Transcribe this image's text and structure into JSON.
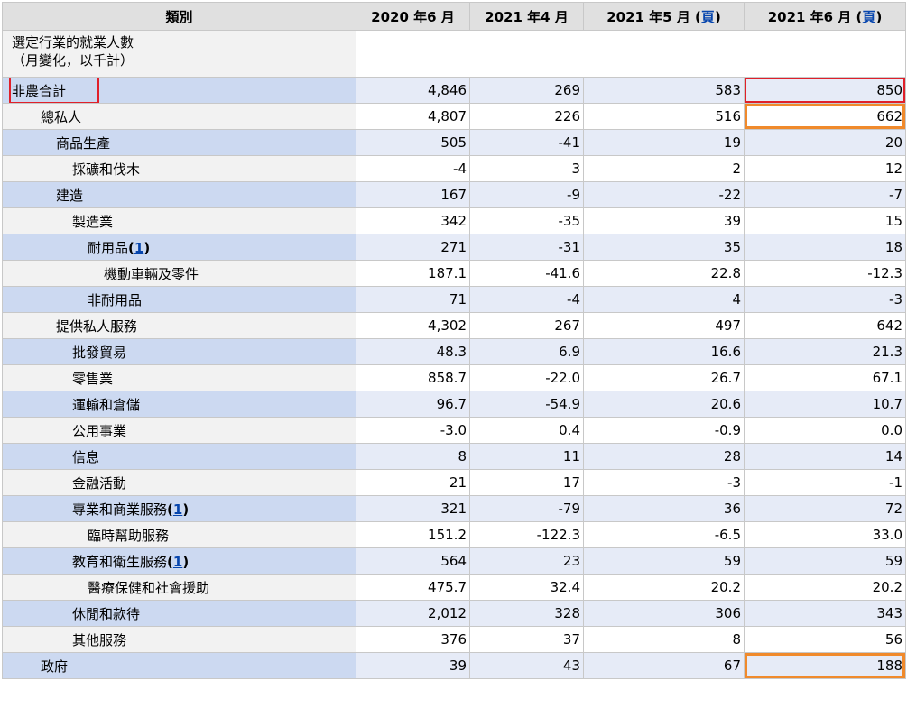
{
  "header": {
    "category": "類別",
    "col1": "2020 年6 月",
    "col2": "2021 年4 月",
    "col3_prefix": "2021 年5 月 (",
    "col3_link": "頁",
    "col3_suffix": ")",
    "col4_prefix": "2021 年6 月 (",
    "col4_link": "頁",
    "col4_suffix": ")"
  },
  "intro": {
    "line1": "選定行業的就業人數",
    "line2": "（月變化，以千計）"
  },
  "rows": [
    {
      "label": "非農合計",
      "note": "",
      "v": [
        "4,846",
        "269",
        "583",
        "850"
      ]
    },
    {
      "label": "總私人",
      "note": "",
      "v": [
        "4,807",
        "226",
        "516",
        "662"
      ]
    },
    {
      "label": "商品生產",
      "note": "",
      "v": [
        "505",
        "-41",
        "19",
        "20"
      ]
    },
    {
      "label": "採礦和伐木",
      "note": "",
      "v": [
        "-4",
        "3",
        "2",
        "12"
      ]
    },
    {
      "label": "建造",
      "note": "",
      "v": [
        "167",
        "-9",
        "-22",
        "-7"
      ]
    },
    {
      "label": "製造業",
      "note": "",
      "v": [
        "342",
        "-35",
        "39",
        "15"
      ]
    },
    {
      "label": "耐用品",
      "note": "1",
      "v": [
        "271",
        "-31",
        "35",
        "18"
      ]
    },
    {
      "label": "機動車輛及零件",
      "note": "",
      "v": [
        "187.1",
        "-41.6",
        "22.8",
        "-12.3"
      ]
    },
    {
      "label": "非耐用品",
      "note": "",
      "v": [
        "71",
        "-4",
        "4",
        "-3"
      ]
    },
    {
      "label": "提供私人服務",
      "note": "",
      "v": [
        "4,302",
        "267",
        "497",
        "642"
      ]
    },
    {
      "label": "批發貿易",
      "note": "",
      "v": [
        "48.3",
        "6.9",
        "16.6",
        "21.3"
      ]
    },
    {
      "label": "零售業",
      "note": "",
      "v": [
        "858.7",
        "-22.0",
        "26.7",
        "67.1"
      ]
    },
    {
      "label": "運輸和倉儲",
      "note": "",
      "v": [
        "96.7",
        "-54.9",
        "20.6",
        "10.7"
      ]
    },
    {
      "label": "公用事業",
      "note": "",
      "v": [
        "-3.0",
        "0.4",
        "-0.9",
        "0.0"
      ]
    },
    {
      "label": "信息",
      "note": "",
      "v": [
        "8",
        "11",
        "28",
        "14"
      ]
    },
    {
      "label": "金融活動",
      "note": "",
      "v": [
        "21",
        "17",
        "-3",
        "-1"
      ]
    },
    {
      "label": "專業和商業服務",
      "note": "1",
      "v": [
        "321",
        "-79",
        "36",
        "72"
      ]
    },
    {
      "label": "臨時幫助服務",
      "note": "",
      "v": [
        "151.2",
        "-122.3",
        "-6.5",
        "33.0"
      ]
    },
    {
      "label": "教育和衛生服務",
      "note": "1",
      "v": [
        "564",
        "23",
        "59",
        "59"
      ]
    },
    {
      "label": "醫療保健和社會援助",
      "note": "",
      "v": [
        "475.7",
        "32.4",
        "20.2",
        "20.2"
      ]
    },
    {
      "label": "休閒和款待",
      "note": "",
      "v": [
        "2,012",
        "328",
        "306",
        "343"
      ]
    },
    {
      "label": "其他服務",
      "note": "",
      "v": [
        "376",
        "37",
        "8",
        "56"
      ]
    },
    {
      "label": "政府",
      "note": "",
      "v": [
        "39",
        "43",
        "67",
        "188"
      ]
    }
  ],
  "highlights": {
    "red_color": "#e0202a",
    "orange_color": "#f08a2c"
  },
  "colors": {
    "header_bg": "#e0e0e0",
    "row_tint": "#e6ebf7",
    "category_tint": "#ccd9f1",
    "link": "#0645ad"
  }
}
